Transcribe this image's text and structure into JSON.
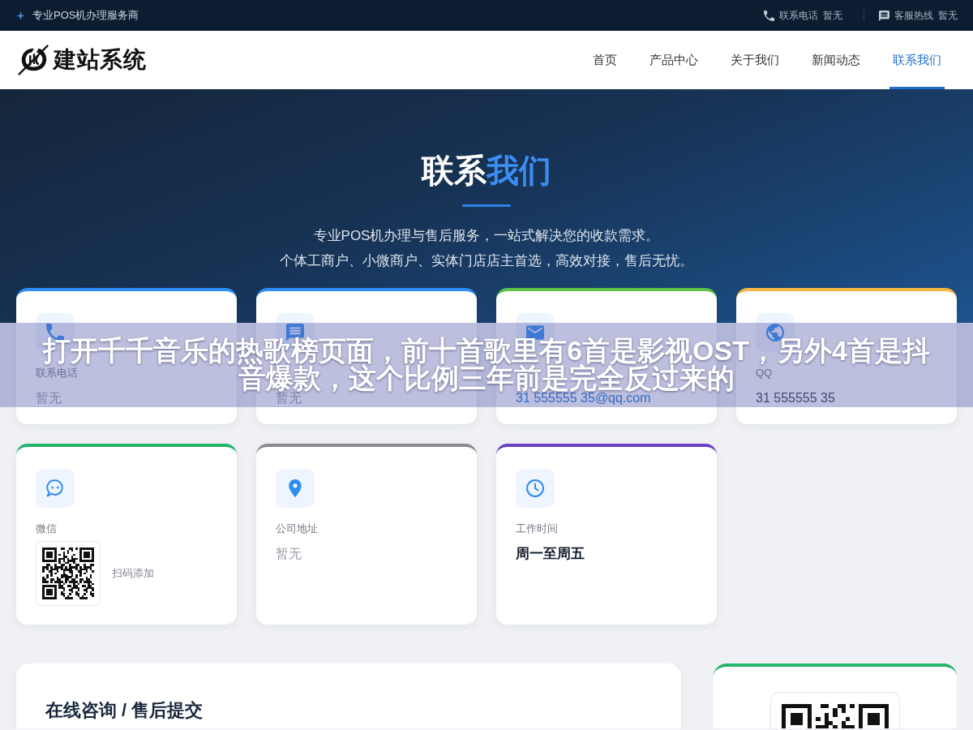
{
  "top_bar": {
    "slogan": "专业POS机办理服务商",
    "contacts": [
      {
        "kind": "phone",
        "label": "联系电话",
        "value": "暂无"
      },
      {
        "kind": "hotline",
        "label": "客服热线",
        "value": "暂无"
      }
    ]
  },
  "header": {
    "logo_text": "建站系统",
    "nav": [
      {
        "label": "首页",
        "selected": false
      },
      {
        "label": "产品中心",
        "selected": false
      },
      {
        "label": "关于我们",
        "selected": false
      },
      {
        "label": "新闻动态",
        "selected": false
      },
      {
        "label": "联系我们",
        "selected": true
      }
    ]
  },
  "hero": {
    "title": "联系",
    "title_accent": "我们",
    "subtitle_lines": [
      "专业POS机办理与售后服务，一站式解决您的收款需求。",
      "个体工商户、小微商户、实体门店店主首选，高效对接，售后无忧。"
    ]
  },
  "info_cards": [
    {
      "kind": "phone",
      "color": "#2d8cf0",
      "label": "联系电话",
      "value": "暂无",
      "empty": true
    },
    {
      "kind": "hotline",
      "color": "#2d8cf0",
      "value": "暂无",
      "empty": true
    },
    {
      "kind": "email",
      "color": "#5bc24a",
      "value": "31 555555 35@qq.com",
      "empty": false
    },
    {
      "kind": "qq",
      "color": "#f4b63f",
      "label": "QQ",
      "value": "31 555555 35",
      "empty": false
    },
    {
      "kind": "wechat",
      "color": "#22b46c",
      "label": "微信",
      "note": "扫码添加"
    },
    {
      "kind": "address",
      "color": "#8c8c8c",
      "label": "公司地址",
      "value": "暂无",
      "empty": true
    },
    {
      "kind": "hours",
      "color": "#6a40c6",
      "label": "工作时间",
      "value": "周一至周五",
      "empty": false
    }
  ],
  "bottom_panels": [
    {
      "kind": "form",
      "title": "在线咨询 / 售后提交"
    },
    {
      "kind": "qr"
    }
  ],
  "overlay_caption_lines": [
    "打开千千音乐的热歌榜页面，前十首歌里有6首是影视OST，另外4首是抖",
    "音爆款，这个比例三年前是完全反过来的"
  ]
}
